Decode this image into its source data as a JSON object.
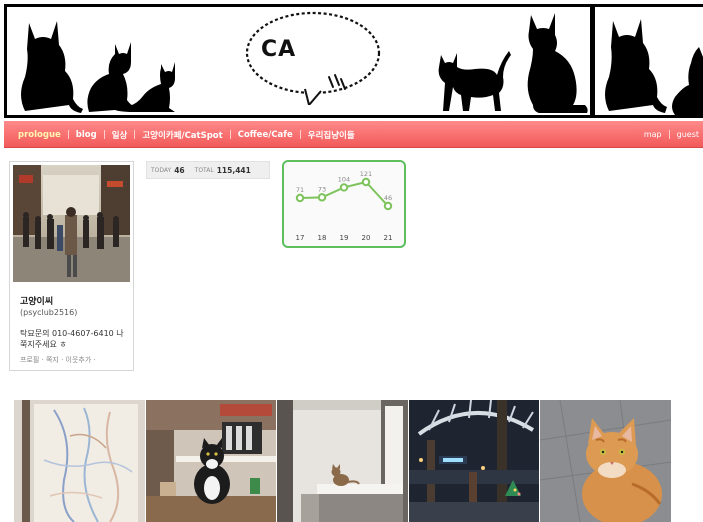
{
  "banner": {
    "bubble_text": "CA"
  },
  "nav": {
    "items": [
      {
        "label": "prologue",
        "active": true
      },
      {
        "label": "blog"
      },
      {
        "label": "일상"
      },
      {
        "label": "고양이카페/CatSpot"
      },
      {
        "label": "Coffee/Cafe"
      },
      {
        "label": "우리집냥이들"
      }
    ],
    "right": [
      {
        "label": "map"
      },
      {
        "label": "guest"
      }
    ]
  },
  "profile": {
    "name": "고양이씨",
    "id": "(psyclub2516)",
    "desc": "탁묘문의 010-4607-6410 나쭉지주세요 ㅎ",
    "links": "프로필 · 쪽지 · 이웃추가 ·"
  },
  "counter": {
    "today_label": "TODAY",
    "today_value": "46",
    "total_label": "TOTAL",
    "total_value": "115,441"
  },
  "chart_data": {
    "type": "line",
    "categories": [
      "17",
      "18",
      "19",
      "20",
      "21"
    ],
    "values": [
      71,
      73,
      104,
      121,
      46
    ],
    "color": "#7dc35b",
    "grid": false
  },
  "colors": {
    "nav": "#f25a5a",
    "chart_border": "#5fbf5f",
    "chart_line": "#7dc35b"
  }
}
